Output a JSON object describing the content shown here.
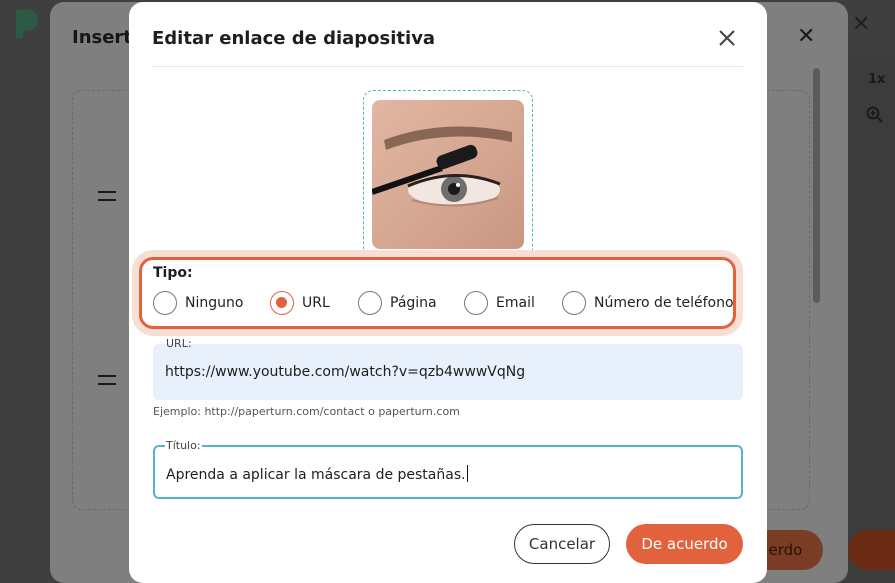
{
  "background": {
    "zoom_label": "1x",
    "mid_dialog_title": "Inserta",
    "mid_ok_label": "uerdo"
  },
  "dialog": {
    "title": "Editar enlace de diapositiva",
    "tipo": {
      "label": "Tipo:",
      "options": [
        "Ninguno",
        "URL",
        "Página",
        "Email",
        "Número de teléfono"
      ],
      "selected": "URL"
    },
    "url": {
      "label": "URL:",
      "value": "https://www.youtube.com/watch?v=qzb4wwwVqNg",
      "example": "Ejemplo: http://paperturn.com/contact o paperturn.com"
    },
    "titulo": {
      "label": "Título:",
      "value": "Aprenda a aplicar la máscara de pestañas."
    },
    "buttons": {
      "cancel": "Cancelar",
      "ok": "De acuerdo"
    }
  },
  "colors": {
    "accent": "#e2623e",
    "focus": "#4fb7c6"
  }
}
